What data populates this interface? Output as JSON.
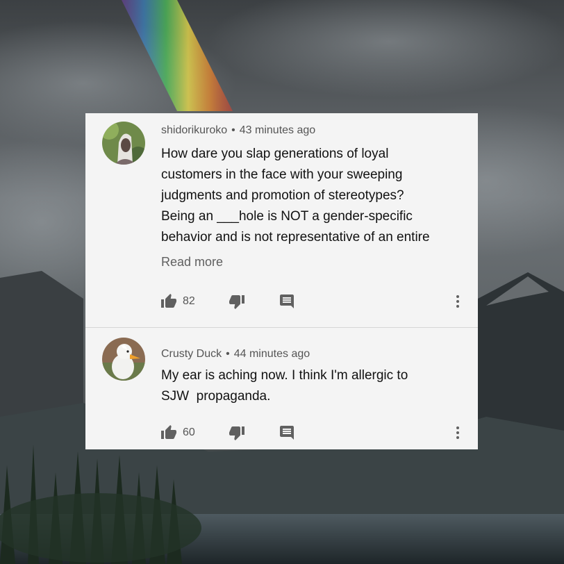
{
  "comments": [
    {
      "author": "shidorikuroko",
      "separator": "•",
      "time": "43 minutes ago",
      "lines": [
        "How dare you slap generations of loyal",
        "customers in the face with your sweeping",
        "judgments and promotion of stereotypes?",
        "Being an ___hole is NOT a gender-specific",
        "behavior and is not representative of an entire"
      ],
      "read_more": "Read more",
      "likes": "82",
      "avatar_icon": "person-with-white-hair-avatar"
    },
    {
      "author": "Crusty Duck",
      "separator": "•",
      "time": "44 minutes ago",
      "lines": [
        "My ear is aching now. I think I'm allergic to",
        "SJW  propaganda."
      ],
      "likes": "60",
      "avatar_icon": "white-duck-avatar"
    }
  ],
  "icons": {
    "like": "thumbs-up-icon",
    "dislike": "thumbs-down-icon",
    "reply": "reply-comment-icon",
    "more": "more-vertical-icon"
  },
  "colors": {
    "card_background": "#f4f4f4",
    "icon_gray": "#606060",
    "text": "#111111",
    "meta_text": "#555555"
  }
}
